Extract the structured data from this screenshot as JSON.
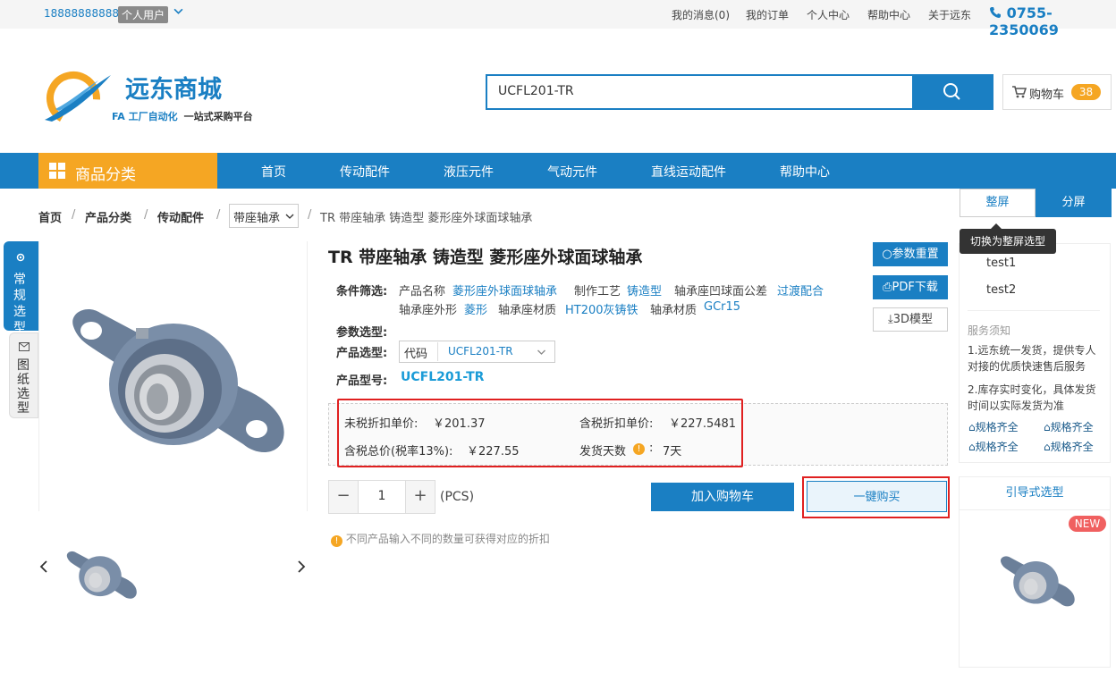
{
  "topbar": {
    "phone": "18888888888",
    "user_tag": "个人用户",
    "links": [
      "我的消息(0)",
      "我的订单",
      "个人中心",
      "帮助中心",
      "关于远东"
    ],
    "hotline": "0755-2350069"
  },
  "header": {
    "logo_title": "远东商城",
    "logo_fa": "FA 工厂自动化",
    "logo_slogan": "一站式采购平台",
    "search_value": "UCFL201-TR",
    "cart_label": "购物车",
    "cart_count": "38"
  },
  "nav": {
    "category": "商品分类",
    "items": [
      "首页",
      "传动配件",
      "液压元件",
      "气动元件",
      "直线运动配件",
      "帮助中心"
    ]
  },
  "breadcrumb": {
    "items": [
      "首页",
      "产品分类",
      "传动配件"
    ],
    "select": "带座轴承",
    "current": "TR 带座轴承 铸造型 菱形座外球面球轴承"
  },
  "side_tabs": {
    "tab1": "常规选型",
    "tab2": "图纸选型"
  },
  "product": {
    "title": "TR 带座轴承 铸造型 菱形座外球面球轴承",
    "filter_label": "条件筛选:",
    "attrs_row1": [
      {
        "name": "产品名称",
        "value": "菱形座外球面球轴承"
      },
      {
        "name": "制作工艺",
        "value": "铸造型"
      },
      {
        "name": "轴承座凹球面公差",
        "value": "过渡配合"
      }
    ],
    "attrs_row2": [
      {
        "name": "轴承座外形",
        "value": "菱形"
      },
      {
        "name": "轴承座材质",
        "value": "HT200灰铸铁"
      },
      {
        "name": "轴承材质",
        "value": "GCr15"
      }
    ],
    "param_label": "参数选型:",
    "select_label": "产品选型:",
    "select_code": "代码",
    "select_value": "UCFL201-TR",
    "model_label": "产品型号:",
    "model_value": "UCFL201-TR"
  },
  "price": {
    "untaxed_label": "未税折扣单价:",
    "untaxed_value": "￥201.37",
    "taxed_label": "含税折扣单价:",
    "taxed_value": "￥227.5481",
    "total_label": "含税总价(税率13%):",
    "total_value": "￥227.55",
    "ship_label": "发货天数",
    "ship_value": "7天"
  },
  "purchase": {
    "qty": "1",
    "unit": "(PCS)",
    "add_cart": "加入购物车",
    "buy_now": "一键购买",
    "note": "不同产品输入不同的数量可获得对应的折扣"
  },
  "actions": {
    "reset": "参数重置",
    "pdf": "PDF下载",
    "model3d": "3D模型"
  },
  "right": {
    "tab_whole": "整屏",
    "tab_split": "分屏",
    "tooltip": "切换为整屏选型",
    "items": [
      "test1",
      "test2"
    ],
    "service_title": "服务须知",
    "service_1": "1.远东统一发货，提供专人对接的优质快速售后服务",
    "service_2": "2.库存实时变化，具体发货时间以实际发货为准",
    "features": [
      "规格齐全",
      "规格齐全",
      "规格齐全",
      "规格齐全"
    ],
    "guide_title": "引导式选型",
    "new_badge": "NEW"
  },
  "colors": {
    "brand_blue": "#1a7fc3",
    "accent_orange": "#f5a623",
    "highlight_red": "#e02020"
  }
}
